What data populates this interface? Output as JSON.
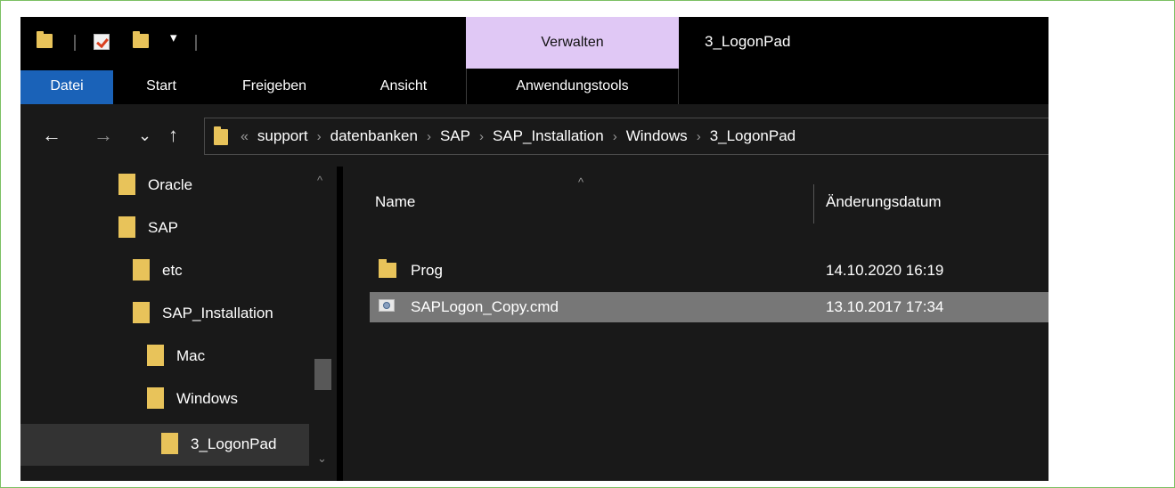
{
  "window": {
    "title": "3_LogonPad"
  },
  "quick_access": {
    "icons": [
      "folder-icon",
      "properties-icon",
      "new-folder-icon",
      "customize-dropdown-icon"
    ],
    "more_glyph": "▾"
  },
  "ribbon": {
    "context_group": "Verwalten",
    "context_tab": "Anwendungstools",
    "tabs": [
      "Datei",
      "Start",
      "Freigeben",
      "Ansicht"
    ]
  },
  "navigation": {
    "back": "←",
    "forward": "→",
    "recent": "⌄",
    "up": "↑"
  },
  "address": {
    "overflow": "«",
    "separator": "›",
    "crumbs": [
      "support",
      "datenbanken",
      "SAP",
      "SAP_Installation",
      "Windows",
      "3_LogonPad"
    ]
  },
  "nav_tree": {
    "items": [
      {
        "label": "Oracle"
      },
      {
        "label": "SAP"
      },
      {
        "label": "etc"
      },
      {
        "label": "SAP_Installation"
      },
      {
        "label": "Mac"
      },
      {
        "label": "Windows"
      },
      {
        "label": "3_LogonPad",
        "selected": true
      }
    ],
    "scroll_up": "^",
    "scroll_down": "⌄"
  },
  "file_list": {
    "sort_indicator": "^",
    "columns": {
      "name": "Name",
      "date": "Änderungsdatum"
    },
    "rows": [
      {
        "name": "Prog",
        "date": "14.10.2020 16:19",
        "icon": "folder-icon",
        "selected": false
      },
      {
        "name": "SAPLogon_Copy.cmd",
        "date": "13.10.2017 17:34",
        "icon": "cmd-file-icon",
        "selected": true
      }
    ]
  },
  "colors": {
    "accent_file_tab": "#1a62b8",
    "context_tab": "#e0c8f5",
    "folder": "#e8c35a",
    "selection": "#777777",
    "frame_border": "#7cc063"
  }
}
